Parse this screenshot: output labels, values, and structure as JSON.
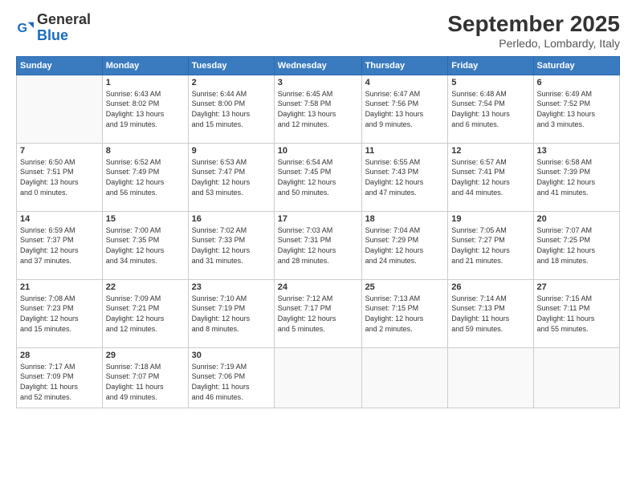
{
  "header": {
    "logo": {
      "general": "General",
      "blue": "Blue"
    },
    "title": "September 2025",
    "location": "Perledo, Lombardy, Italy"
  },
  "days_of_week": [
    "Sunday",
    "Monday",
    "Tuesday",
    "Wednesday",
    "Thursday",
    "Friday",
    "Saturday"
  ],
  "weeks": [
    [
      {
        "day": "",
        "info": ""
      },
      {
        "day": "1",
        "info": "Sunrise: 6:43 AM\nSunset: 8:02 PM\nDaylight: 13 hours\nand 19 minutes."
      },
      {
        "day": "2",
        "info": "Sunrise: 6:44 AM\nSunset: 8:00 PM\nDaylight: 13 hours\nand 15 minutes."
      },
      {
        "day": "3",
        "info": "Sunrise: 6:45 AM\nSunset: 7:58 PM\nDaylight: 13 hours\nand 12 minutes."
      },
      {
        "day": "4",
        "info": "Sunrise: 6:47 AM\nSunset: 7:56 PM\nDaylight: 13 hours\nand 9 minutes."
      },
      {
        "day": "5",
        "info": "Sunrise: 6:48 AM\nSunset: 7:54 PM\nDaylight: 13 hours\nand 6 minutes."
      },
      {
        "day": "6",
        "info": "Sunrise: 6:49 AM\nSunset: 7:52 PM\nDaylight: 13 hours\nand 3 minutes."
      }
    ],
    [
      {
        "day": "7",
        "info": "Sunrise: 6:50 AM\nSunset: 7:51 PM\nDaylight: 13 hours\nand 0 minutes."
      },
      {
        "day": "8",
        "info": "Sunrise: 6:52 AM\nSunset: 7:49 PM\nDaylight: 12 hours\nand 56 minutes."
      },
      {
        "day": "9",
        "info": "Sunrise: 6:53 AM\nSunset: 7:47 PM\nDaylight: 12 hours\nand 53 minutes."
      },
      {
        "day": "10",
        "info": "Sunrise: 6:54 AM\nSunset: 7:45 PM\nDaylight: 12 hours\nand 50 minutes."
      },
      {
        "day": "11",
        "info": "Sunrise: 6:55 AM\nSunset: 7:43 PM\nDaylight: 12 hours\nand 47 minutes."
      },
      {
        "day": "12",
        "info": "Sunrise: 6:57 AM\nSunset: 7:41 PM\nDaylight: 12 hours\nand 44 minutes."
      },
      {
        "day": "13",
        "info": "Sunrise: 6:58 AM\nSunset: 7:39 PM\nDaylight: 12 hours\nand 41 minutes."
      }
    ],
    [
      {
        "day": "14",
        "info": "Sunrise: 6:59 AM\nSunset: 7:37 PM\nDaylight: 12 hours\nand 37 minutes."
      },
      {
        "day": "15",
        "info": "Sunrise: 7:00 AM\nSunset: 7:35 PM\nDaylight: 12 hours\nand 34 minutes."
      },
      {
        "day": "16",
        "info": "Sunrise: 7:02 AM\nSunset: 7:33 PM\nDaylight: 12 hours\nand 31 minutes."
      },
      {
        "day": "17",
        "info": "Sunrise: 7:03 AM\nSunset: 7:31 PM\nDaylight: 12 hours\nand 28 minutes."
      },
      {
        "day": "18",
        "info": "Sunrise: 7:04 AM\nSunset: 7:29 PM\nDaylight: 12 hours\nand 24 minutes."
      },
      {
        "day": "19",
        "info": "Sunrise: 7:05 AM\nSunset: 7:27 PM\nDaylight: 12 hours\nand 21 minutes."
      },
      {
        "day": "20",
        "info": "Sunrise: 7:07 AM\nSunset: 7:25 PM\nDaylight: 12 hours\nand 18 minutes."
      }
    ],
    [
      {
        "day": "21",
        "info": "Sunrise: 7:08 AM\nSunset: 7:23 PM\nDaylight: 12 hours\nand 15 minutes."
      },
      {
        "day": "22",
        "info": "Sunrise: 7:09 AM\nSunset: 7:21 PM\nDaylight: 12 hours\nand 12 minutes."
      },
      {
        "day": "23",
        "info": "Sunrise: 7:10 AM\nSunset: 7:19 PM\nDaylight: 12 hours\nand 8 minutes."
      },
      {
        "day": "24",
        "info": "Sunrise: 7:12 AM\nSunset: 7:17 PM\nDaylight: 12 hours\nand 5 minutes."
      },
      {
        "day": "25",
        "info": "Sunrise: 7:13 AM\nSunset: 7:15 PM\nDaylight: 12 hours\nand 2 minutes."
      },
      {
        "day": "26",
        "info": "Sunrise: 7:14 AM\nSunset: 7:13 PM\nDaylight: 11 hours\nand 59 minutes."
      },
      {
        "day": "27",
        "info": "Sunrise: 7:15 AM\nSunset: 7:11 PM\nDaylight: 11 hours\nand 55 minutes."
      }
    ],
    [
      {
        "day": "28",
        "info": "Sunrise: 7:17 AM\nSunset: 7:09 PM\nDaylight: 11 hours\nand 52 minutes."
      },
      {
        "day": "29",
        "info": "Sunrise: 7:18 AM\nSunset: 7:07 PM\nDaylight: 11 hours\nand 49 minutes."
      },
      {
        "day": "30",
        "info": "Sunrise: 7:19 AM\nSunset: 7:06 PM\nDaylight: 11 hours\nand 46 minutes."
      },
      {
        "day": "",
        "info": ""
      },
      {
        "day": "",
        "info": ""
      },
      {
        "day": "",
        "info": ""
      },
      {
        "day": "",
        "info": ""
      }
    ]
  ]
}
